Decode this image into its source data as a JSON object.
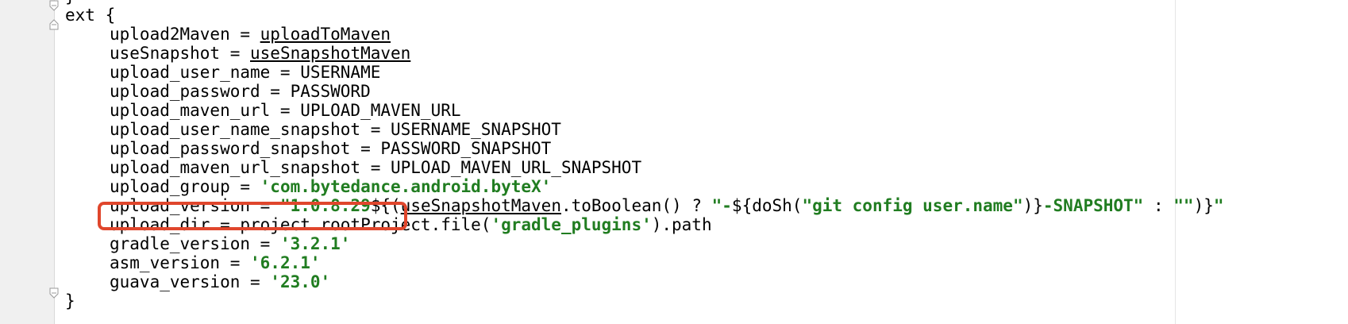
{
  "lines": [
    {
      "indent": false,
      "parts": [
        {
          "t": "}",
          "c": ""
        }
      ]
    },
    {
      "indent": false,
      "parts": [
        {
          "t": "ext {",
          "c": ""
        }
      ]
    },
    {
      "indent": true,
      "parts": [
        {
          "t": "upload2Maven = ",
          "c": ""
        },
        {
          "t": "uploadToMaven",
          "c": "u"
        }
      ]
    },
    {
      "indent": true,
      "parts": [
        {
          "t": "useSnapshot = ",
          "c": ""
        },
        {
          "t": "useSnapshotMaven",
          "c": "u"
        }
      ]
    },
    {
      "indent": true,
      "parts": [
        {
          "t": "upload_user_name = USERNAME",
          "c": ""
        }
      ]
    },
    {
      "indent": true,
      "parts": [
        {
          "t": "upload_password = PASSWORD",
          "c": ""
        }
      ]
    },
    {
      "indent": true,
      "parts": [
        {
          "t": "upload_maven_url = UPLOAD_MAVEN_URL",
          "c": ""
        }
      ]
    },
    {
      "indent": true,
      "parts": [
        {
          "t": "upload_user_name_snapshot = USERNAME_SNAPSHOT",
          "c": ""
        }
      ]
    },
    {
      "indent": true,
      "parts": [
        {
          "t": "upload_password_snapshot = PASSWORD_SNAPSHOT",
          "c": ""
        }
      ]
    },
    {
      "indent": true,
      "parts": [
        {
          "t": "upload_maven_url_snapshot = UPLOAD_MAVEN_URL_SNAPSHOT",
          "c": ""
        }
      ]
    },
    {
      "indent": true,
      "parts": [
        {
          "t": "upload_group = ",
          "c": ""
        },
        {
          "t": "'com.bytedance.android.byteX'",
          "c": "str"
        }
      ]
    },
    {
      "indent": true,
      "parts": [
        {
          "t": "upload_version = ",
          "c": ""
        },
        {
          "t": "\"1.0.8.29",
          "c": "str"
        },
        {
          "t": "${(",
          "c": ""
        },
        {
          "t": "useSnapshotMaven",
          "c": "u"
        },
        {
          "t": ".toBoolean() ? ",
          "c": ""
        },
        {
          "t": "\"-",
          "c": "str"
        },
        {
          "t": "${doSh(",
          "c": ""
        },
        {
          "t": "\"git config user.name\"",
          "c": "str"
        },
        {
          "t": ")}",
          "c": ""
        },
        {
          "t": "-SNAPSHOT\"",
          "c": "str"
        },
        {
          "t": " : ",
          "c": ""
        },
        {
          "t": "\"\"",
          "c": "str"
        },
        {
          "t": ")}",
          "c": ""
        },
        {
          "t": "\"",
          "c": "str"
        }
      ]
    },
    {
      "indent": true,
      "parts": [
        {
          "t": "upload_dir = project.rootProject.file(",
          "c": ""
        },
        {
          "t": "'gradle_plugins'",
          "c": "str"
        },
        {
          "t": ").path",
          "c": ""
        }
      ]
    },
    {
      "indent": true,
      "parts": [
        {
          "t": "gradle_version = ",
          "c": ""
        },
        {
          "t": "'3.2.1'",
          "c": "str"
        }
      ]
    },
    {
      "indent": true,
      "parts": [
        {
          "t": "asm_version = ",
          "c": ""
        },
        {
          "t": "'6.2.1'",
          "c": "str"
        }
      ]
    },
    {
      "indent": true,
      "parts": [
        {
          "t": "guava_version = ",
          "c": ""
        },
        {
          "t": "'23.0'",
          "c": "str"
        }
      ]
    },
    {
      "indent": false,
      "parts": [
        {
          "t": "}",
          "c": ""
        }
      ]
    }
  ],
  "highlight_color": "#e0462c",
  "string_color": "#217d21"
}
